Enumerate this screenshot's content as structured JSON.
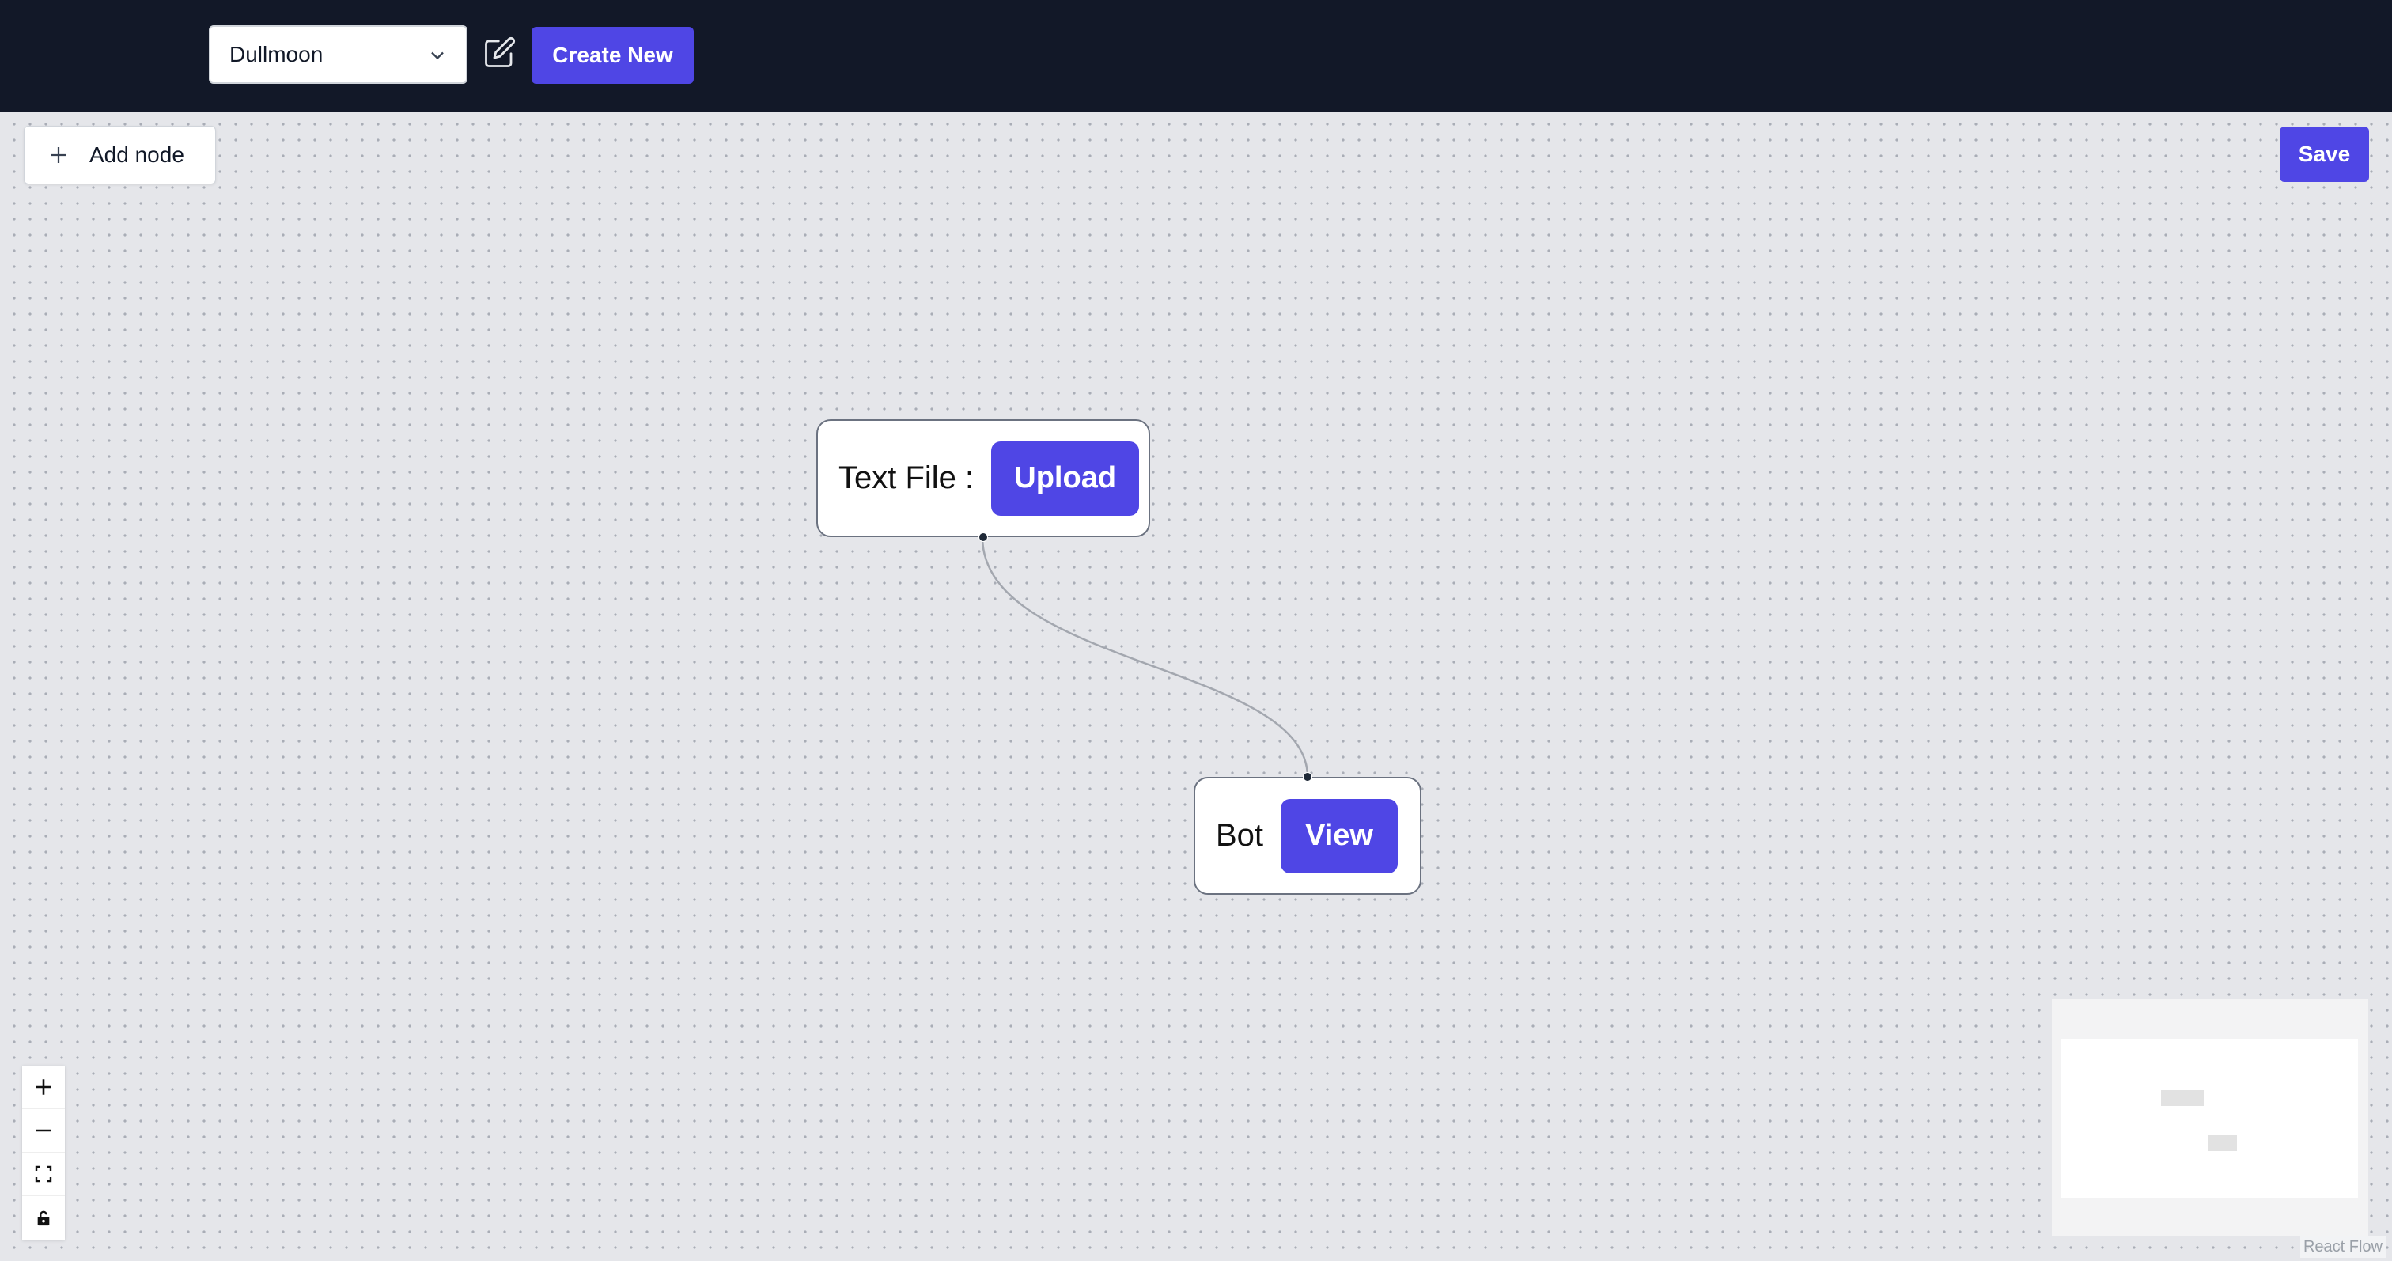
{
  "header": {
    "project_select_value": "Dullmoon",
    "create_new_label": "Create New"
  },
  "toolbar": {
    "add_node_label": "Add node",
    "save_label": "Save"
  },
  "nodes": [
    {
      "label": "Text File :",
      "action_label": "Upload"
    },
    {
      "label": "Bot",
      "action_label": "View"
    }
  ],
  "controls": [
    "zoom-in-icon",
    "zoom-out-icon",
    "fit-view-icon",
    "lock-icon"
  ],
  "attribution": "React Flow",
  "colors": {
    "topbar": "#121828",
    "primary": "#4f46e5",
    "canvas": "#e5e6ea"
  }
}
